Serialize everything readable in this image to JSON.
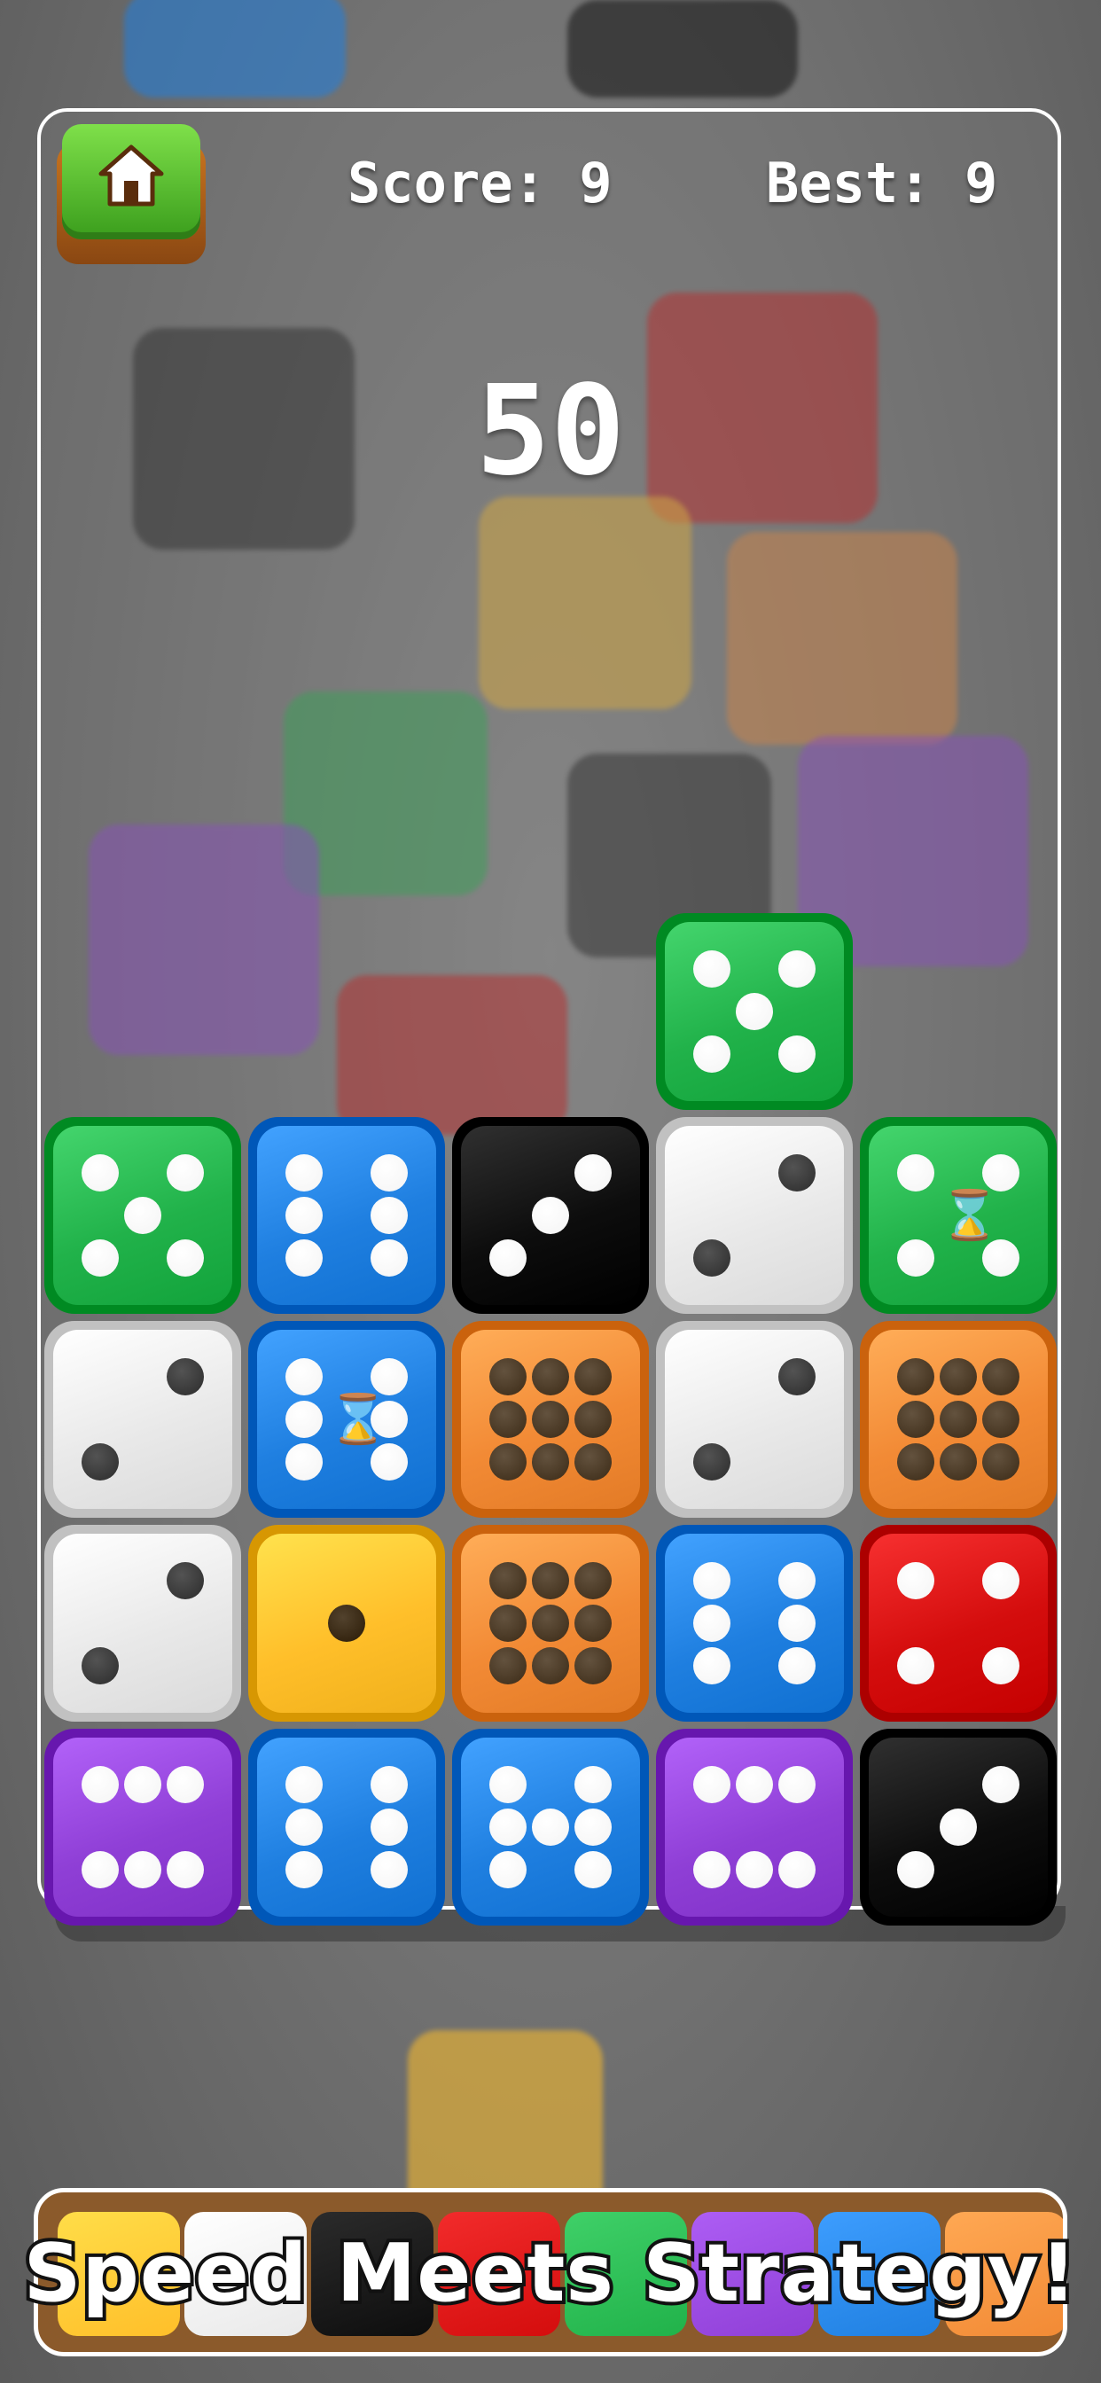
{
  "hud": {
    "home_label": "Home",
    "score": "Score: 9",
    "best": "Best: 9",
    "timer": "50"
  },
  "tagline": "Speed Meets Strategy!",
  "colors": {
    "green": "#21b24a",
    "blue": "#1f7fe0",
    "black": "#0d0d0d",
    "white": "#e9e9e9",
    "orange": "#f28a35",
    "yellow": "#ffbf2a",
    "red": "#d40d0d",
    "purple": "#8f3fd6"
  },
  "board": {
    "falling": {
      "color": "green",
      "value": 5
    },
    "rows": [
      [
        {
          "color": "green",
          "value": 5
        },
        {
          "color": "blue",
          "value": 6
        },
        {
          "color": "black",
          "value": 3
        },
        {
          "color": "white",
          "value": 2
        },
        {
          "color": "green",
          "value": 4,
          "bonus": "hourglass-icon"
        }
      ],
      [
        {
          "color": "white",
          "value": 2
        },
        {
          "color": "blue",
          "value": 6,
          "bonus": "hourglass-icon"
        },
        {
          "color": "orange",
          "value": 9
        },
        {
          "color": "white",
          "value": 2
        },
        {
          "color": "orange",
          "value": 9
        }
      ],
      [
        {
          "color": "white",
          "value": 2
        },
        {
          "color": "yellow",
          "value": 1
        },
        {
          "color": "orange",
          "value": 9
        },
        {
          "color": "blue",
          "value": 6
        },
        {
          "color": "red",
          "value": 4
        }
      ],
      [
        {
          "color": "purple",
          "value": 6
        },
        {
          "color": "blue",
          "value": 6
        },
        {
          "color": "blue",
          "value": 5
        },
        {
          "color": "purple",
          "value": 6
        },
        {
          "color": "black",
          "value": 3
        }
      ]
    ]
  },
  "tray_colors": [
    "yellow",
    "white",
    "black",
    "red",
    "green",
    "purple",
    "blue",
    "orange"
  ]
}
